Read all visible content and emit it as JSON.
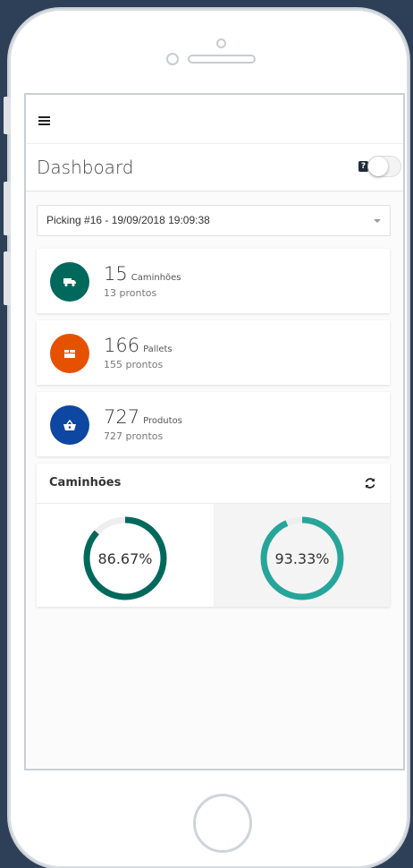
{
  "app": {
    "page_title": "Dashboard",
    "help_label": "?"
  },
  "filter": {
    "selected": "Picking #16 - 19/09/2018 19:09:38"
  },
  "stats": [
    {
      "value": "15",
      "unit": "Caminhões",
      "sub": "13 prontos",
      "icon": "truck-icon",
      "color": "#00695c"
    },
    {
      "value": "166",
      "unit": "Pallets",
      "sub": "155 prontos",
      "icon": "pallet-icon",
      "color": "#e65100"
    },
    {
      "value": "727",
      "unit": "Produtos",
      "sub": "727 prontos",
      "icon": "basket-icon",
      "color": "#0d47a1"
    }
  ],
  "chart_card": {
    "title": "Caminhões"
  },
  "chart_data": {
    "type": "pie",
    "charts": [
      {
        "value": 86.67,
        "label": "86.67%",
        "color": "#00695c"
      },
      {
        "value": 93.33,
        "label": "93.33%",
        "color": "#26a69a"
      }
    ]
  },
  "colors": {
    "track": "#eeeeee"
  }
}
